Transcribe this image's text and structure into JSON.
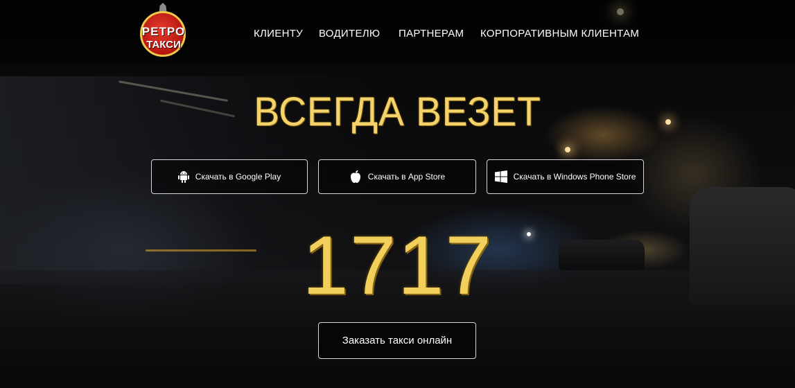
{
  "logo": {
    "line1": "РЕТРО",
    "line2": "ТАКСИ"
  },
  "nav": [
    {
      "label": "КЛИЕНТУ"
    },
    {
      "label": "ВОДИТЕЛЮ"
    },
    {
      "label": "ПАРТНЕРАМ"
    },
    {
      "label": "КОРПОРАТИВНЫМ КЛИЕНТАМ"
    }
  ],
  "hero": {
    "headline": "ВСЕГДА ВЕЗЕТ",
    "phone": "1717",
    "order_label": "Заказать такси онлайн"
  },
  "stores": [
    {
      "label": "Скачать в Google Play",
      "icon": "android-icon"
    },
    {
      "label": "Скачать в App Store",
      "icon": "apple-icon"
    },
    {
      "label": "Скачать в Windows Phone Store",
      "icon": "windows-icon"
    }
  ],
  "colors": {
    "accent_gold": "#f1cf5a",
    "logo_red": "#d3261b",
    "button_border": "#d8d8d8",
    "text": "#ffffff"
  }
}
